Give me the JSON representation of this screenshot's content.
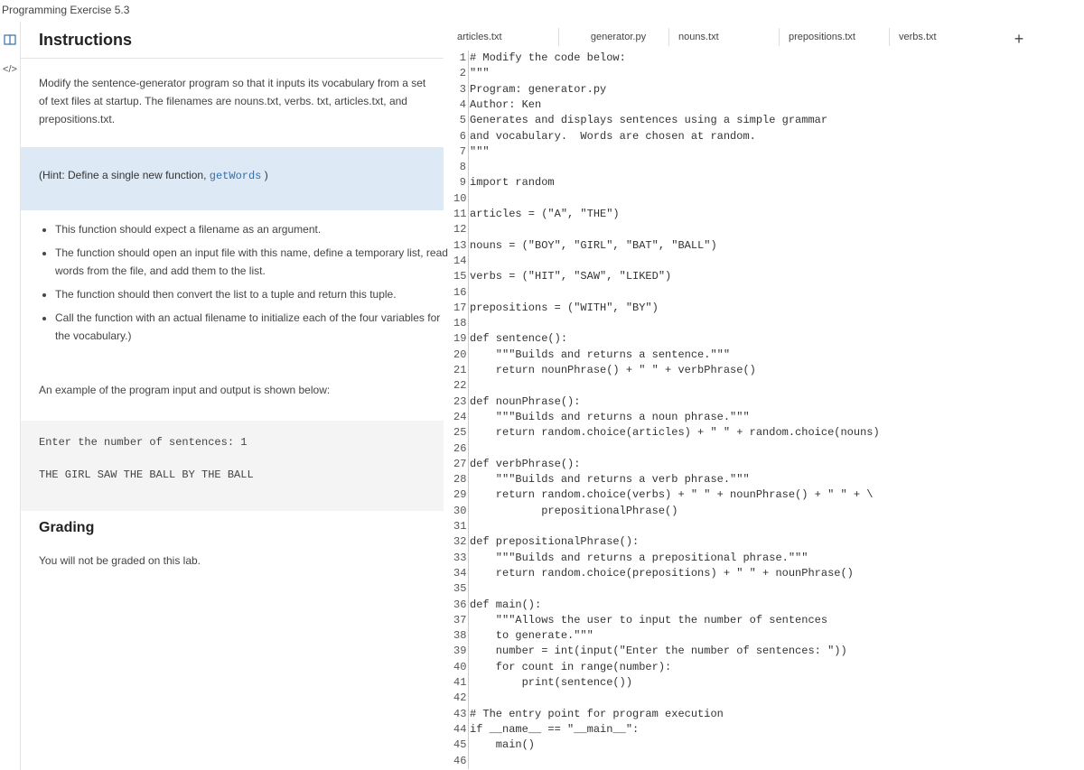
{
  "app": {
    "title": "Programming Exercise 5.3"
  },
  "rail": {
    "book_icon": "book-icon",
    "code_icon": "code-icon",
    "code_glyph": "</>"
  },
  "instructions": {
    "header": "Instructions",
    "intro": "Modify the sentence-generator program so that it inputs its vocabulary from a set of text files at startup. The filenames are nouns.txt, verbs. txt, articles.txt, and prepositions.txt.",
    "hint_prefix": "(Hint: Define a single new function, ",
    "hint_code": "getWords",
    "hint_suffix": " )",
    "bullets": [
      "This function should expect a filename as an argument.",
      "The function should open an input file with this name, define a temporary list, read words from the file, and add them to the list.",
      "The function should then convert the list to a tuple and return this tuple.",
      "Call the function with an actual filename to initialize each of the four variables for the vocabulary.)"
    ],
    "example_intro": "An example of the program input and output is shown below:",
    "sample_input": "Enter the number of sentences: 1",
    "sample_output": "THE GIRL SAW THE BALL BY THE BALL",
    "grading_title": "Grading",
    "grading_text": "You will not be graded on this lab."
  },
  "editor": {
    "tabs": [
      {
        "label": "articles.txt",
        "active": false
      },
      {
        "label": "generator.py",
        "active": true
      },
      {
        "label": "nouns.txt",
        "active": false
      },
      {
        "label": "prepositions.txt",
        "active": false
      },
      {
        "label": "verbs.txt",
        "active": false
      }
    ],
    "add_tab": "+",
    "lines": [
      "# Modify the code below:",
      "\"\"\"",
      "Program: generator.py",
      "Author: Ken",
      "Generates and displays sentences using a simple grammar",
      "and vocabulary.  Words are chosen at random.",
      "\"\"\"",
      "",
      "import random",
      "",
      "articles = (\"A\", \"THE\")",
      "",
      "nouns = (\"BOY\", \"GIRL\", \"BAT\", \"BALL\")",
      "",
      "verbs = (\"HIT\", \"SAW\", \"LIKED\")",
      "",
      "prepositions = (\"WITH\", \"BY\")",
      "",
      "def sentence():",
      "    \"\"\"Builds and returns a sentence.\"\"\"",
      "    return nounPhrase() + \" \" + verbPhrase()",
      "",
      "def nounPhrase():",
      "    \"\"\"Builds and returns a noun phrase.\"\"\"",
      "    return random.choice(articles) + \" \" + random.choice(nouns)",
      "",
      "def verbPhrase():",
      "    \"\"\"Builds and returns a verb phrase.\"\"\"",
      "    return random.choice(verbs) + \" \" + nounPhrase() + \" \" + \\",
      "           prepositionalPhrase()",
      "",
      "def prepositionalPhrase():",
      "    \"\"\"Builds and returns a prepositional phrase.\"\"\"",
      "    return random.choice(prepositions) + \" \" + nounPhrase()",
      "",
      "def main():",
      "    \"\"\"Allows the user to input the number of sentences",
      "    to generate.\"\"\"",
      "    number = int(input(\"Enter the number of sentences: \"))",
      "    for count in range(number):",
      "        print(sentence())",
      "",
      "# The entry point for program execution",
      "if __name__ == \"__main__\":",
      "    main()",
      ""
    ]
  }
}
